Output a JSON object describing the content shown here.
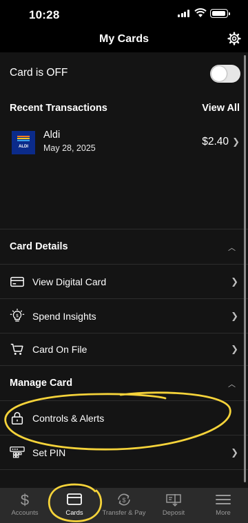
{
  "status_bar": {
    "time": "10:28"
  },
  "header": {
    "title": "My Cards",
    "settings_icon": "gear-icon"
  },
  "card_toggle": {
    "label": "Card is OFF",
    "enabled": false
  },
  "recent_transactions": {
    "title": "Recent Transactions",
    "view_all": "View All",
    "items": [
      {
        "merchant": "Aldi",
        "logo_text": "ALDI",
        "date": "May 28, 2025",
        "amount": "$2.40"
      }
    ]
  },
  "card_details": {
    "title": "Card Details",
    "items": [
      {
        "label": "View Digital Card",
        "icon": "credit-card-icon"
      },
      {
        "label": "Spend Insights",
        "icon": "lightbulb-dollar-icon"
      },
      {
        "label": "Card On File",
        "icon": "shopping-cart-icon"
      }
    ]
  },
  "manage_card": {
    "title": "Manage Card",
    "items": [
      {
        "label": "Controls & Alerts",
        "icon": "lock-icon"
      },
      {
        "label": "Set PIN",
        "icon": "pin-keypad-icon"
      }
    ]
  },
  "tab_bar": {
    "active": "Cards",
    "tabs": [
      {
        "label": "Accounts",
        "icon": "dollar-icon"
      },
      {
        "label": "Cards",
        "icon": "card-icon"
      },
      {
        "label": "Transfer & Pay",
        "icon": "transfer-icon"
      },
      {
        "label": "Deposit",
        "icon": "check-deposit-icon"
      },
      {
        "label": "More",
        "icon": "menu-icon"
      }
    ]
  },
  "colors": {
    "background": "#000000",
    "row_background": "#141414",
    "tab_bar": "#2b2b2b",
    "annotation": "#f5d33a",
    "aldi_blue": "#0b2b8a"
  }
}
